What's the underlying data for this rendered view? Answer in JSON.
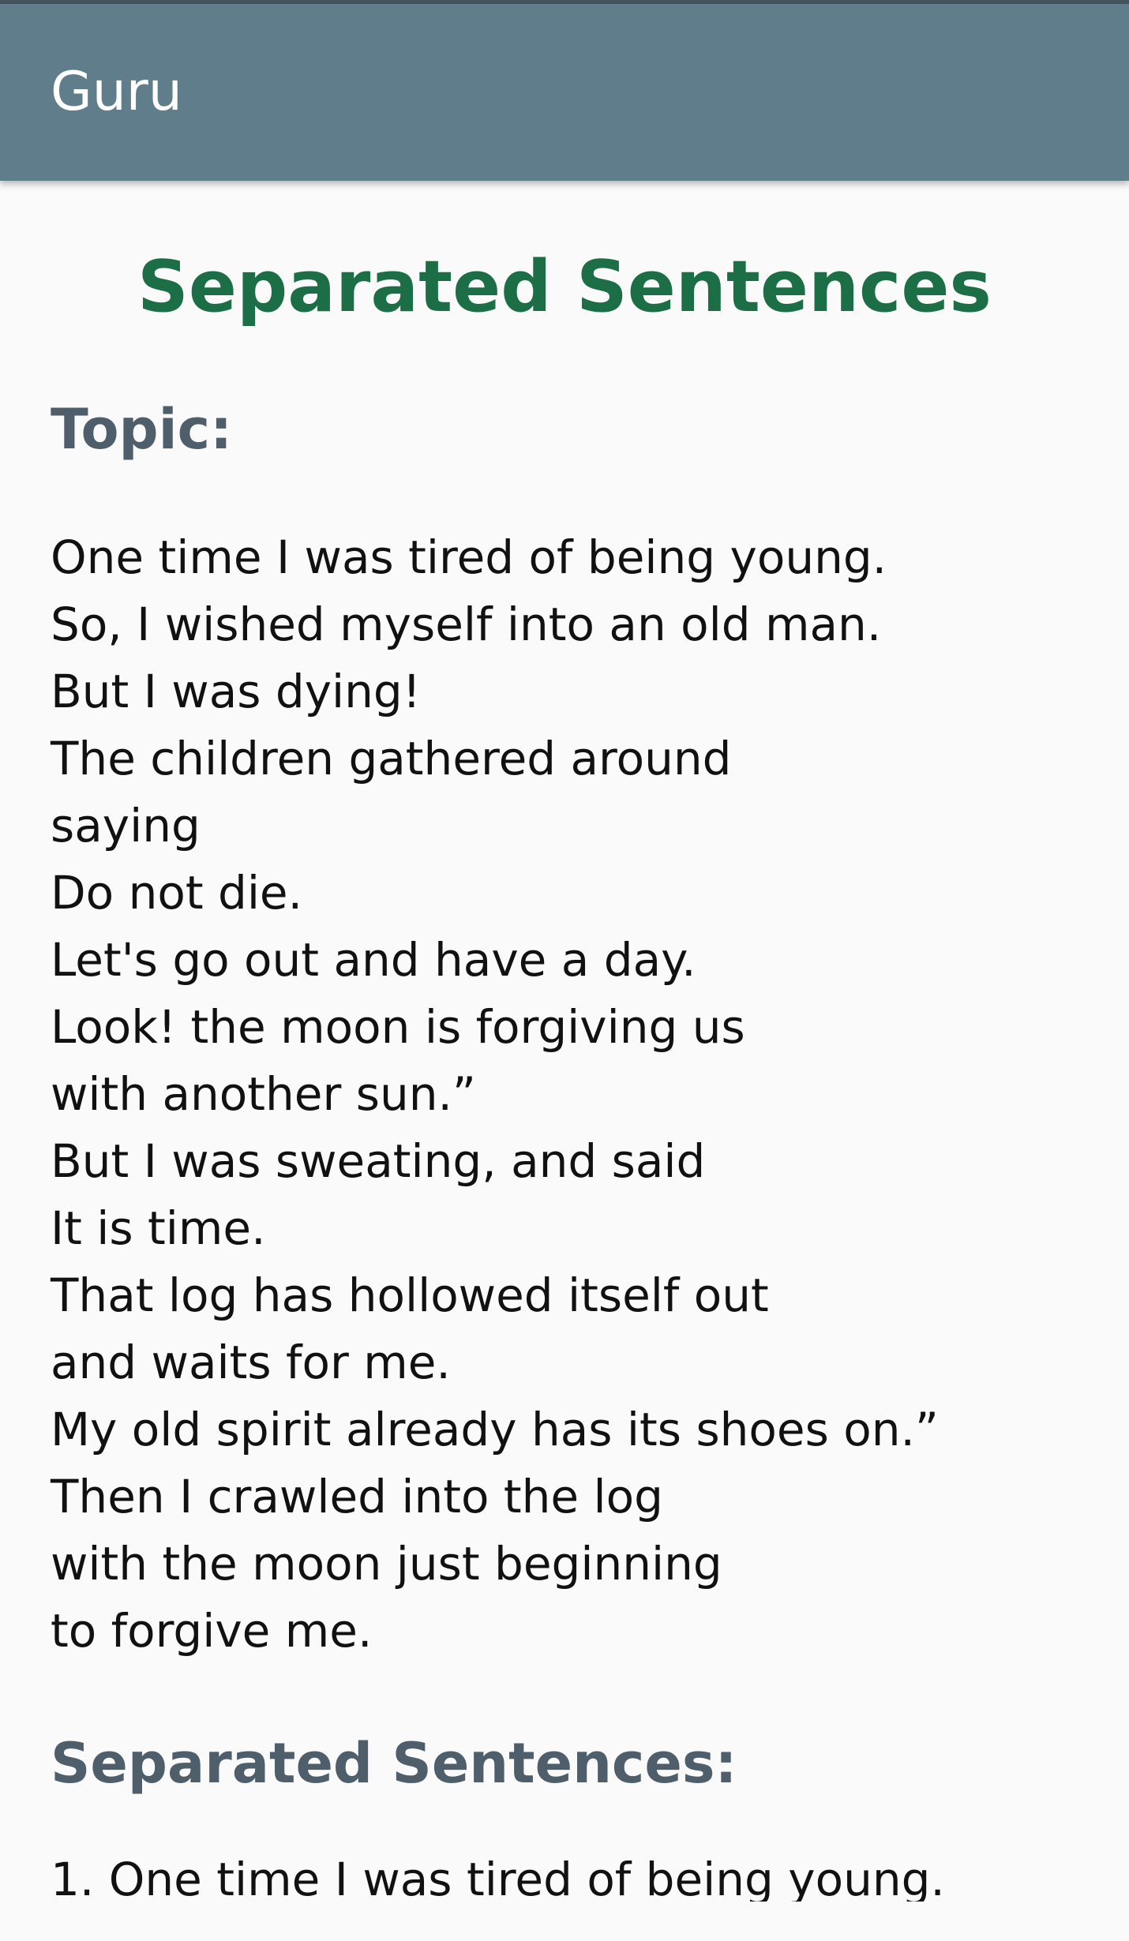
{
  "app_bar": {
    "title": "Guru"
  },
  "page": {
    "heading": "Separated Sentences",
    "topic_label": "Topic:",
    "topic_lines": [
      "One time I was tired of being young.",
      "So, I wished myself into an old man.",
      "But I was dying!",
      "The children gathered around",
      "saying",
      "Do not die.",
      "Let's go out and have a day.",
      "Look! the moon is forgiving us",
      "with another sun.”",
      "But I was sweating, and said",
      "It is time.",
      "That log has hollowed itself out",
      "and waits for me.",
      "My old spirit already has its shoes on.”",
      "Then I crawled into the log",
      "with the moon just beginning",
      "to forgive me."
    ],
    "sentences_label": "Separated Sentences:",
    "sentences": [
      "1. One time I was tired of being young."
    ]
  },
  "colors": {
    "app_bar": "#607d8b",
    "heading": "#1b6e45",
    "section_label": "#4e5e6a",
    "background": "#fafafa"
  }
}
